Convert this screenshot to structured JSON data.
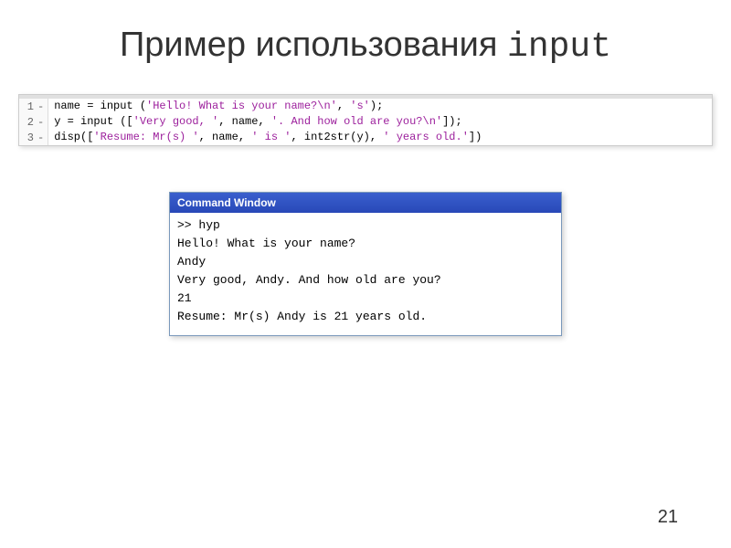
{
  "title": {
    "text": "Пример использования ",
    "mono": "input"
  },
  "code": {
    "lines": [
      {
        "num": "1",
        "dash": "-",
        "pre": "name = input (",
        "str1": "'Hello! What is your name?\\n'",
        "mid1": ", ",
        "str2": "'s'",
        "post": ");"
      },
      {
        "num": "2",
        "dash": "-",
        "pre": "y = input ([",
        "str1": "'Very good, '",
        "mid1": ", name, ",
        "str2": "'. And how old are you?\\n'",
        "post": "]);"
      },
      {
        "num": "3",
        "dash": "-",
        "pre": "disp([",
        "str1": "'Resume: Mr(s) '",
        "mid1": ", name, ",
        "str2": "' is '",
        "mid2": ", int2str(y), ",
        "str3": "' years old.'",
        "post": "])"
      }
    ]
  },
  "commandWindow": {
    "title": "Command Window",
    "lines": [
      ">> hyp",
      "Hello! What is your name?",
      "Andy",
      "Very good, Andy. And how old are you?",
      "21",
      "Resume: Mr(s) Andy is 21 years old."
    ]
  },
  "pageNumber": "21"
}
